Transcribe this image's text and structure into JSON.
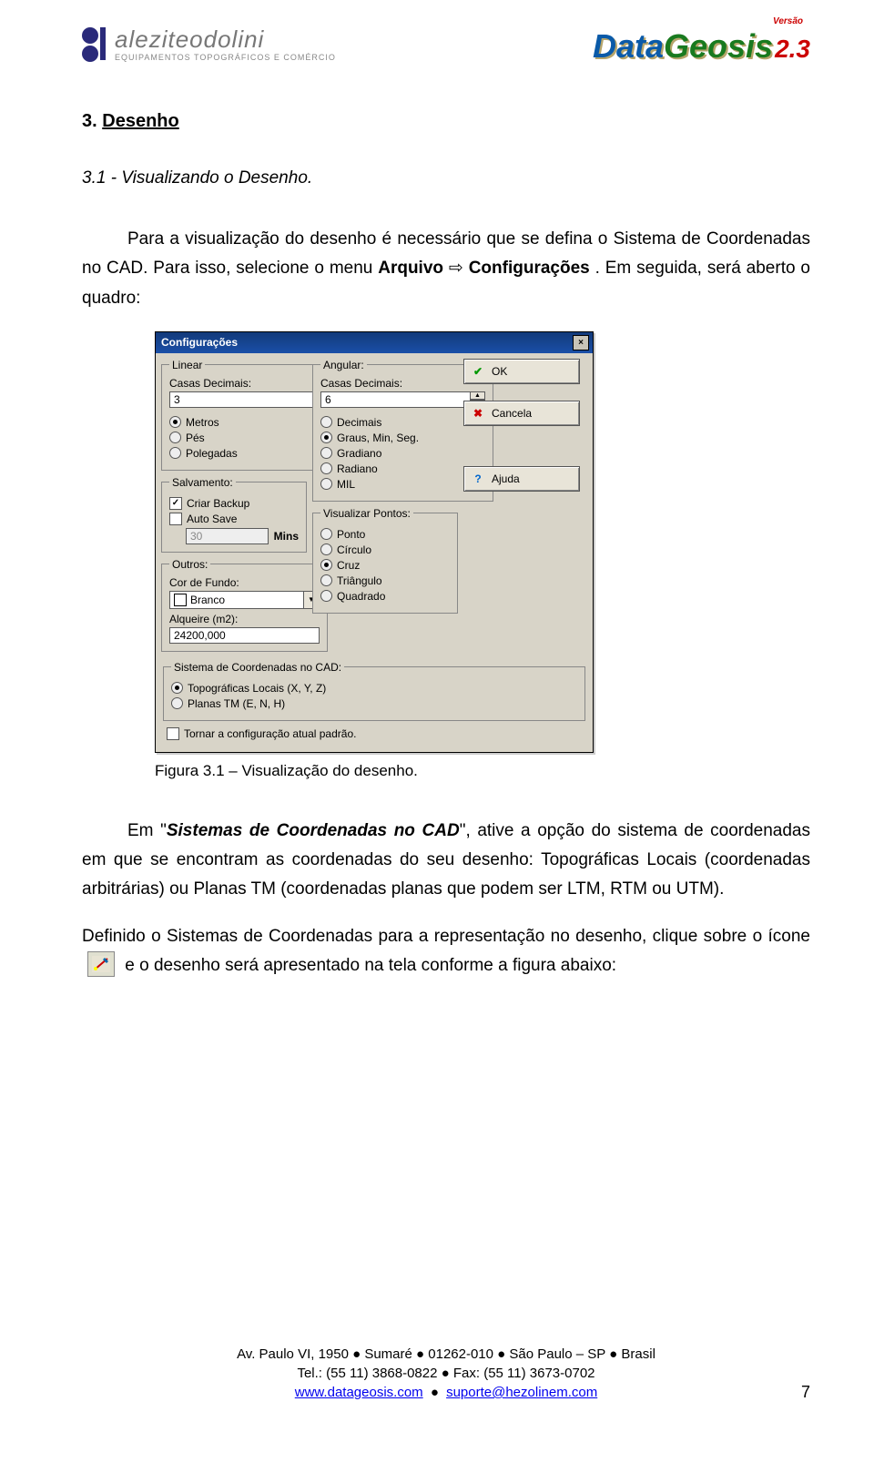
{
  "header": {
    "company_name": "aleziteodolini",
    "company_sub": "EQUIPAMENTOS TOPOGRÁFICOS E COMÉRCIO",
    "product_name_a": "Data",
    "product_name_b": "Geosis",
    "product_ver": "2.3",
    "product_ver_label": "Versão"
  },
  "section": {
    "num": "3.",
    "title": "Desenho"
  },
  "subsection": {
    "num": "3.1 -",
    "title": "Visualizando o Desenho."
  },
  "para1_a": "Para a visualização do desenho é necessário que se defina o Sistema de Coordenadas no CAD. Para isso, selecione o menu ",
  "para1_b": "Arquivo ",
  "para1_c": " Configurações",
  "para1_d": ". Em seguida, será aberto o quadro:",
  "caption": "Figura 3.1 – Visualização do desenho.",
  "para2_a": "Em ",
  "para2_q1": "\"",
  "para2_b": "Sistemas de Coordenadas no CAD",
  "para2_q2": "\"",
  "para2_c": ", ative a opção do sistema de coordenadas em que se encontram as coordenadas do seu desenho: Topográficas Locais (coordenadas arbitrárias) ou Planas TM (coordenadas planas que podem ser LTM, RTM ou UTM).",
  "para3_a": "Definido o Sistemas de Coordenadas para a representação no desenho, clique sobre o ícone ",
  "para3_b": " e o desenho será apresentado na tela conforme a figura abaixo:",
  "dialog": {
    "title": "Configurações",
    "ok": "OK",
    "cancel": "Cancela",
    "help": "Ajuda",
    "linear": {
      "legend": "Linear",
      "casas_label": "Casas Decimais:",
      "casas_value": "3",
      "units": [
        "Metros",
        "Pés",
        "Polegadas"
      ],
      "unit_selected": 0
    },
    "angular": {
      "legend": "Angular:",
      "casas_label": "Casas Decimais:",
      "casas_value": "6",
      "modes": [
        "Decimais",
        "Graus, Min, Seg.",
        "Gradiano",
        "Radiano",
        "MIL"
      ],
      "mode_selected": 1
    },
    "salvamento": {
      "legend": "Salvamento:",
      "criar_backup": "Criar Backup",
      "auto_save": "Auto Save",
      "mins_value": "30",
      "mins_label": "Mins"
    },
    "visualizar": {
      "legend": "Visualizar Pontos:",
      "options": [
        "Ponto",
        "Círculo",
        "Cruz",
        "Triângulo",
        "Quadrado"
      ],
      "selected": 2
    },
    "outros": {
      "legend": "Outros:",
      "cor_label": "Cor de Fundo:",
      "cor_value": "Branco",
      "alq_label": "Alqueire (m2):",
      "alq_value": "24200,000"
    },
    "sistema": {
      "legend": "Sistema de Coordenadas no CAD:",
      "options": [
        "Topográficas Locais (X, Y, Z)",
        "Planas TM (E, N, H)"
      ],
      "selected": 0
    },
    "tornar_padrao": "Tornar a configuração atual padrão."
  },
  "footer": {
    "addr": "Av. Paulo VI, 1950 ● Sumaré ● 01262-010 ● São Paulo – SP ● Brasil",
    "tel": "Tel.: (55 11) 3868-0822 ● Fax: (55 11) 3673-0702",
    "web": "www.datageosis.com",
    "mail": "suporte@hezolinem.com",
    "page": "7"
  }
}
